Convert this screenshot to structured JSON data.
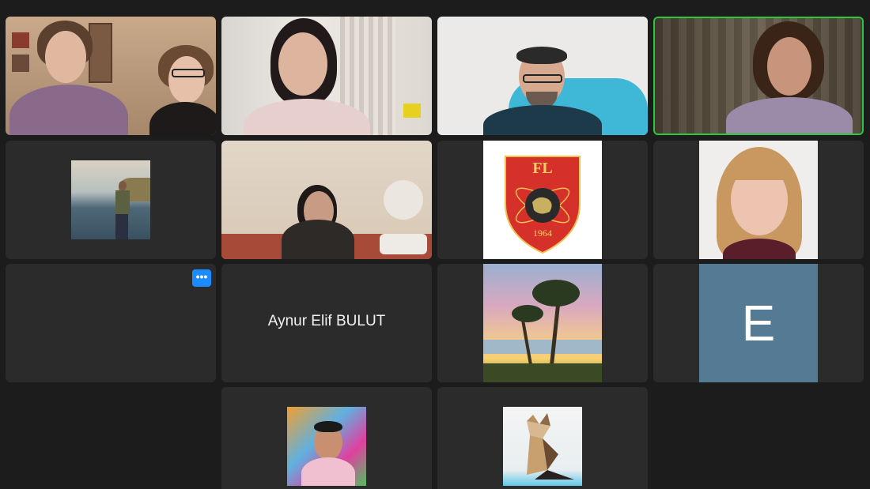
{
  "meeting": {
    "participants": [
      {
        "id": "p1",
        "type": "video",
        "speaking": false
      },
      {
        "id": "p2",
        "type": "video",
        "speaking": false
      },
      {
        "id": "p3",
        "type": "video",
        "speaking": false
      },
      {
        "id": "p4",
        "type": "video",
        "speaking": true
      },
      {
        "id": "p5",
        "type": "photo-avatar",
        "icon": "person-by-lake-photo"
      },
      {
        "id": "p6",
        "type": "video",
        "speaking": false
      },
      {
        "id": "p7",
        "type": "logo-avatar",
        "icon": "fl-crest-logo",
        "logo_letters": "FL",
        "logo_year": "1964"
      },
      {
        "id": "p8",
        "type": "photo-avatar",
        "icon": "woman-portrait-photo"
      },
      {
        "id": "p9",
        "type": "blank",
        "more_label": "•••"
      },
      {
        "id": "p10",
        "type": "name-only",
        "name": "Aynur Elif BULUT"
      },
      {
        "id": "p11",
        "type": "photo-avatar",
        "icon": "palm-trees-sunset-photo"
      },
      {
        "id": "p12",
        "type": "initial-avatar",
        "initial": "E"
      },
      {
        "id": "p13",
        "type": "photo-avatar",
        "icon": "man-graffiti-photo"
      },
      {
        "id": "p14",
        "type": "photo-avatar",
        "icon": "origami-cat-photo"
      }
    ]
  },
  "colors": {
    "background": "#1c1c1c",
    "tile": "#2b2b2b",
    "active_speaker": "#27c93f",
    "more_button": "#1a8cff",
    "initial_avatar": "#557a93"
  }
}
